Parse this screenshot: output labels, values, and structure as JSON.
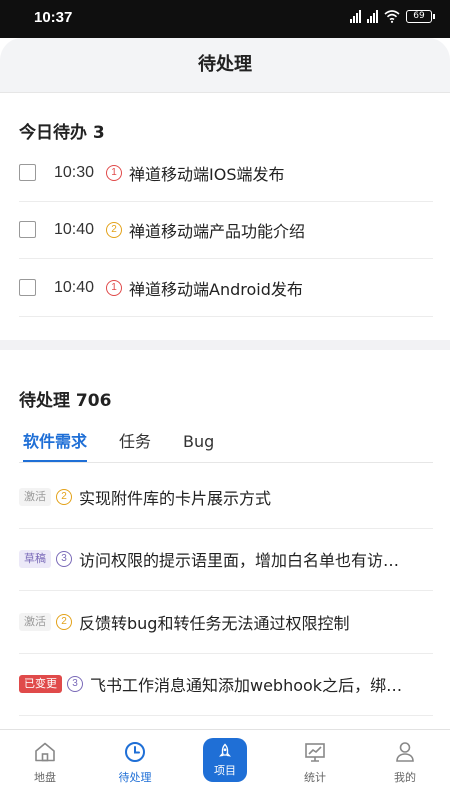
{
  "status_bar": {
    "time": "10:37",
    "battery": "69"
  },
  "header": {
    "title": "待处理"
  },
  "today": {
    "title": "今日待办 3",
    "items": [
      {
        "time": "10:30",
        "priority": "1",
        "text": "禅道移动端IOS端发布"
      },
      {
        "time": "10:40",
        "priority": "2",
        "text": "禅道移动端产品功能介绍"
      },
      {
        "time": "10:40",
        "priority": "1",
        "text": "禅道移动端Android发布"
      }
    ]
  },
  "pending": {
    "title": "待处理 706",
    "tabs": [
      {
        "label": "软件需求",
        "active": true
      },
      {
        "label": "任务",
        "active": false
      },
      {
        "label": "Bug",
        "active": false
      }
    ],
    "items": [
      {
        "status": "激活",
        "priority": "2",
        "text": "实现附件库的卡片展示方式"
      },
      {
        "status": "草稿",
        "priority": "3",
        "text": "访问权限的提示语里面，增加白名单也有访…"
      },
      {
        "status": "激活",
        "priority": "2",
        "text": "反馈转bug和转任务无法通过权限控制"
      },
      {
        "status": "已变更",
        "priority": "3",
        "text": "飞书工作消息通知添加webhook之后，绑…"
      }
    ]
  },
  "nav": {
    "items": [
      {
        "label": "地盘",
        "icon": "home-icon"
      },
      {
        "label": "待处理",
        "icon": "clock-icon"
      },
      {
        "label": "项目",
        "icon": "rocket-icon"
      },
      {
        "label": "统计",
        "icon": "chart-icon"
      },
      {
        "label": "我的",
        "icon": "user-icon"
      }
    ]
  },
  "colors": {
    "accent": "#1f6fd6",
    "priority1": "#e04a4a",
    "priority2": "#e3a21a",
    "priority3": "#7a6ab8"
  }
}
